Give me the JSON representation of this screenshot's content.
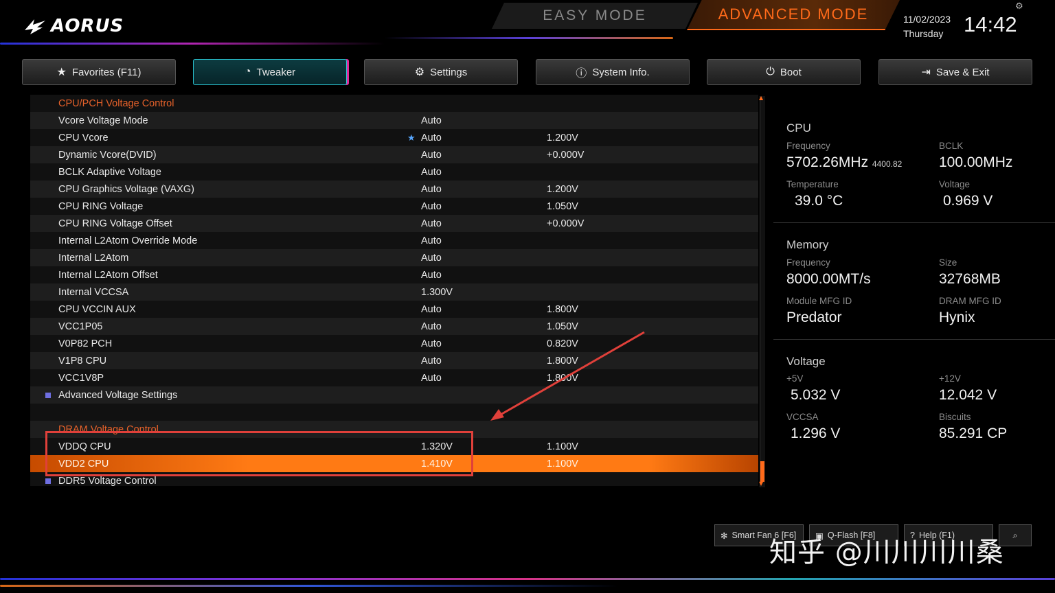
{
  "brand": {
    "logo_text": "AORUS"
  },
  "modes": {
    "easy": "EASY MODE",
    "advanced": "ADVANCED MODE"
  },
  "clock": {
    "date": "11/02/2023",
    "day": "Thursday",
    "time": "14:42"
  },
  "tabs": [
    {
      "label": "Favorites (F11)",
      "icon": "star-icon",
      "active": false
    },
    {
      "label": "Tweaker",
      "icon": "speedometer-icon",
      "active": true
    },
    {
      "label": "Settings",
      "icon": "gear-icon",
      "active": false
    },
    {
      "label": "System Info.",
      "icon": "info-icon",
      "active": false
    },
    {
      "label": "Boot",
      "icon": "power-icon",
      "active": false
    },
    {
      "label": "Save & Exit",
      "icon": "exit-icon",
      "active": false
    }
  ],
  "list": {
    "section_cpu": "CPU/PCH Voltage Control",
    "rows": [
      {
        "name": "Vcore Voltage Mode",
        "value": "Auto",
        "current": ""
      },
      {
        "name": "CPU Vcore",
        "value": "Auto",
        "current": "1.200V"
      },
      {
        "name": "Dynamic Vcore(DVID)",
        "value": "Auto",
        "current": "+0.000V"
      },
      {
        "name": "BCLK Adaptive Voltage",
        "value": "Auto",
        "current": ""
      },
      {
        "name": "CPU Graphics Voltage (VAXG)",
        "value": "Auto",
        "current": "1.200V"
      },
      {
        "name": "CPU RING Voltage",
        "value": "Auto",
        "current": "1.050V"
      },
      {
        "name": "CPU RING Voltage Offset",
        "value": "Auto",
        "current": "+0.000V"
      },
      {
        "name": "Internal L2Atom Override Mode",
        "value": "Auto",
        "current": ""
      },
      {
        "name": "Internal L2Atom",
        "value": "Auto",
        "current": ""
      },
      {
        "name": "Internal L2Atom Offset",
        "value": "Auto",
        "current": ""
      },
      {
        "name": "Internal VCCSA",
        "value": "1.300V",
        "current": ""
      },
      {
        "name": "CPU VCCIN AUX",
        "value": "Auto",
        "current": "1.800V"
      },
      {
        "name": "VCC1P05",
        "value": "Auto",
        "current": "1.050V"
      },
      {
        "name": "V0P82 PCH",
        "value": "Auto",
        "current": "0.820V"
      },
      {
        "name": "V1P8 CPU",
        "value": "Auto",
        "current": "1.800V"
      },
      {
        "name": "VCC1V8P",
        "value": "Auto",
        "current": "1.800V"
      }
    ],
    "advanced_voltage": "Advanced Voltage Settings",
    "section_dram": "DRAM Voltage Control",
    "dram_rows": [
      {
        "name": "VDDQ CPU",
        "value": "1.320V",
        "current": "1.100V"
      },
      {
        "name": "VDD2 CPU",
        "value": "1.410V",
        "current": "1.100V"
      }
    ],
    "ddr5_control": "DDR5 Voltage Control"
  },
  "info": {
    "cpu": {
      "title": "CPU",
      "frequency_label": "Frequency",
      "frequency": "5702.26MHz",
      "frequency_sub": "4400.82",
      "bclk_label": "BCLK",
      "bclk": "100.00MHz",
      "temp_label": "Temperature",
      "temp": "39.0 °C",
      "voltage_label": "Voltage",
      "voltage": "0.969 V"
    },
    "memory": {
      "title": "Memory",
      "frequency_label": "Frequency",
      "frequency": "8000.00MT/s",
      "size_label": "Size",
      "size": "32768MB",
      "module_label": "Module MFG ID",
      "module": "Predator",
      "dram_label": "DRAM MFG ID",
      "dram": "Hynix"
    },
    "voltage": {
      "title": "Voltage",
      "v5_label": "+5V",
      "v5": "5.032 V",
      "v12_label": "+12V",
      "v12": "12.042 V",
      "vccsa_label": "VCCSA",
      "vccsa": "1.296 V",
      "biscuits_label": "Biscuits",
      "biscuits": "85.291 CP"
    }
  },
  "bottom": {
    "smartfan": "Smart Fan 6 [F6]",
    "qflash": "Q-Flash [F8]",
    "help": "Help (F1)"
  },
  "watermark": "知乎 @川川川川桑",
  "colors": {
    "accent": "#ff6a1a",
    "tab_active": "#2ac3d0",
    "section": "#e8622a",
    "annotation": "#e0403a"
  }
}
